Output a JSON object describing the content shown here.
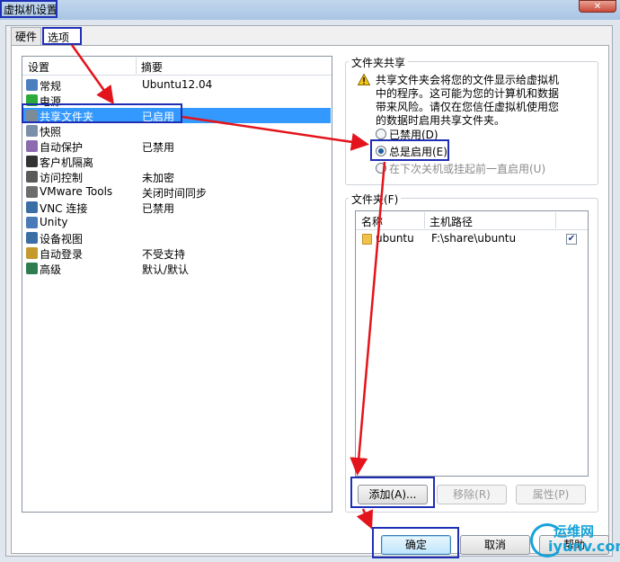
{
  "window": {
    "title": "虚拟机设置",
    "close_glyph": "✕"
  },
  "tabs": [
    {
      "label": "硬件"
    },
    {
      "label": "选项"
    }
  ],
  "settings_list": {
    "columns": [
      "设置",
      "摘要"
    ],
    "items": [
      {
        "name": "常规",
        "summary": "Ubuntu12.04",
        "icon": "general-icon",
        "color": "#4d7fbf"
      },
      {
        "name": "电源",
        "summary": "",
        "icon": "power-icon",
        "color": "#2eaa3a"
      },
      {
        "name": "共享文件夹",
        "summary": "已启用",
        "icon": "shared-folder-icon",
        "color": "#7d8b99",
        "selected": true
      },
      {
        "name": "快照",
        "summary": "",
        "icon": "snapshot-icon",
        "color": "#7b8fa8"
      },
      {
        "name": "自动保护",
        "summary": "已禁用",
        "icon": "autoprotect-icon",
        "color": "#8c6bb0"
      },
      {
        "name": "客户机隔离",
        "summary": "",
        "icon": "isolation-icon",
        "color": "#333333"
      },
      {
        "name": "访问控制",
        "summary": "未加密",
        "icon": "access-control-icon",
        "color": "#5a5a5a"
      },
      {
        "name": "VMware Tools",
        "summary": "关闭时间同步",
        "icon": "vmware-tools-icon",
        "color": "#6d6d6d"
      },
      {
        "name": "VNC 连接",
        "summary": "已禁用",
        "icon": "vnc-icon",
        "color": "#3a6ea5"
      },
      {
        "name": "Unity",
        "summary": "",
        "icon": "unity-icon",
        "color": "#4a7ab8"
      },
      {
        "name": "设备视图",
        "summary": "",
        "icon": "device-view-icon",
        "color": "#3a6ea5"
      },
      {
        "name": "自动登录",
        "summary": "不受支持",
        "icon": "autologin-icon",
        "color": "#c49a2c"
      },
      {
        "name": "高级",
        "summary": "默认/默认",
        "icon": "advanced-icon",
        "color": "#2e7d4f"
      }
    ]
  },
  "folder_sharing": {
    "title": "文件夹共享",
    "warning": "共享文件夹会将您的文件显示给虚拟机中的程序。这可能为您的计算机和数据带来风险。请仅在您信任虚拟机使用您的数据时启用共享文件夹。",
    "options": [
      {
        "label": "已禁用(D)",
        "checked": false,
        "enabled": true
      },
      {
        "label": "总是启用(E)",
        "checked": true,
        "enabled": true
      },
      {
        "label": "在下次关机或挂起前一直启用(U)",
        "checked": false,
        "enabled": false
      }
    ]
  },
  "folders": {
    "title": "文件夹(F)",
    "columns": [
      "名称",
      "主机路径"
    ],
    "rows": [
      {
        "name": "ubuntu",
        "path": "F:\\share\\ubuntu",
        "enabled": true
      }
    ],
    "buttons": {
      "add": "添加(A)...",
      "remove": "移除(R)",
      "properties": "属性(P)"
    }
  },
  "footer": {
    "ok": "确定",
    "cancel": "取消",
    "help": "帮助"
  },
  "watermark": {
    "line1": "运维网",
    "line2": "iyunv.com"
  },
  "annotation_color": "#e3141b"
}
